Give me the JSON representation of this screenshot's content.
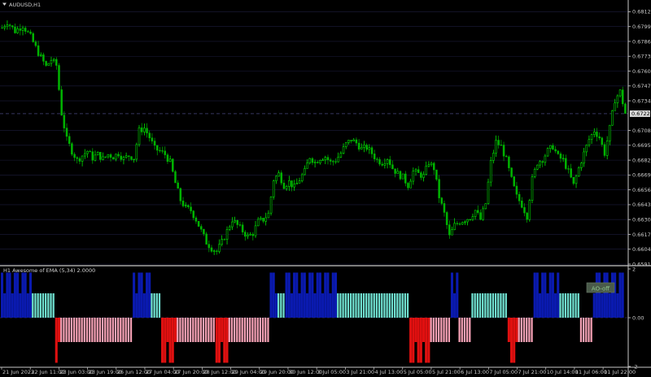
{
  "window": {
    "symbol_title": "AUDUSD,H1",
    "indicator_title": "H1 Awesome of EMA (5,34) 2.0000",
    "ao_button": "AO-off"
  },
  "colors": {
    "background": "#000000",
    "candle_up": "#00ff00",
    "candle_down": "#00b400",
    "grid": "#1c1c3c",
    "price_line": "#363660",
    "current_price_bg": "#d8d8d8",
    "ao_blue": "#0a1ab0",
    "ao_cyan": "#6fe0d0",
    "ao_red": "#e01010",
    "ao_pink": "#f4a0b4",
    "button_bg": "#4a5a4a",
    "button_text": "#8cc68c"
  },
  "icons": {
    "menu": "triangle-down-icon"
  },
  "chart_data": [
    {
      "type": "candlestick",
      "title": "AUDUSD,H1",
      "price_axis_ticks": [
        "0.68120",
        "0.67990",
        "0.67860",
        "0.67730",
        "0.67600",
        "0.67470",
        "0.67340",
        "0.67080",
        "0.66950",
        "0.66820",
        "0.66690",
        "0.66560",
        "0.66430",
        "0.66300",
        "0.66170",
        "0.66040",
        "0.65910"
      ],
      "current_price": "0.67227",
      "ylim": [
        0.6591,
        0.6818
      ],
      "time_axis_labels": [
        "21 Jun 2023",
        "22 Jun 11:00",
        "23 Jun 03:00",
        "23 Jun 19:00",
        "26 Jun 12:00",
        "27 Jun 04:00",
        "27 Jun 20:00",
        "28 Jun 12:00",
        "29 Jun 04:00",
        "29 Jun 20:00",
        "30 Jun 12:00",
        "3 Jul 05:00",
        "3 Jul 21:00",
        "4 Jul 13:00",
        "5 Jul 05:00",
        "5 Jul 21:00",
        "6 Jul 13:00",
        "7 Jul 05:00",
        "7 Jul 21:00",
        "10 Jul 14:00",
        "11 Jul 06:00",
        "11 Jul 22:00"
      ],
      "close_path": [
        [
          0,
          0.6798
        ],
        [
          2,
          0.6803
        ],
        [
          5,
          0.6795
        ],
        [
          8,
          0.68
        ],
        [
          11,
          0.679
        ],
        [
          14,
          0.6776
        ],
        [
          17,
          0.6764
        ],
        [
          19,
          0.677
        ],
        [
          21,
          0.6765
        ],
        [
          23,
          0.6723
        ],
        [
          25,
          0.67
        ],
        [
          27,
          0.669
        ],
        [
          29,
          0.6682
        ],
        [
          31,
          0.6686
        ],
        [
          33,
          0.669
        ],
        [
          35,
          0.6684
        ],
        [
          37,
          0.6687
        ],
        [
          39,
          0.6683
        ],
        [
          41,
          0.6687
        ],
        [
          43,
          0.6685
        ],
        [
          45,
          0.6688
        ],
        [
          47,
          0.6683
        ],
        [
          49,
          0.6686
        ],
        [
          51,
          0.6684
        ],
        [
          53,
          0.6708
        ],
        [
          55,
          0.671
        ],
        [
          57,
          0.6702
        ],
        [
          59,
          0.6692
        ],
        [
          61,
          0.669
        ],
        [
          63,
          0.6687
        ],
        [
          65,
          0.668
        ],
        [
          67,
          0.6662
        ],
        [
          69,
          0.6647
        ],
        [
          71,
          0.664
        ],
        [
          73,
          0.6638
        ],
        [
          75,
          0.663
        ],
        [
          77,
          0.662
        ],
        [
          79,
          0.661
        ],
        [
          81,
          0.6605
        ],
        [
          83,
          0.6602
        ],
        [
          85,
          0.661
        ],
        [
          87,
          0.662
        ],
        [
          89,
          0.663
        ],
        [
          91,
          0.6625
        ],
        [
          93,
          0.662
        ],
        [
          95,
          0.6615
        ],
        [
          97,
          0.6618
        ],
        [
          99,
          0.6628
        ],
        [
          101,
          0.663
        ],
        [
          103,
          0.6635
        ],
        [
          105,
          0.6665
        ],
        [
          107,
          0.667
        ],
        [
          109,
          0.666
        ],
        [
          111,
          0.6663
        ],
        [
          113,
          0.6658
        ],
        [
          115,
          0.6665
        ],
        [
          117,
          0.6672
        ],
        [
          119,
          0.6685
        ],
        [
          121,
          0.668
        ],
        [
          123,
          0.6684
        ],
        [
          125,
          0.6685
        ],
        [
          127,
          0.668
        ],
        [
          129,
          0.6682
        ],
        [
          131,
          0.6688
        ],
        [
          133,
          0.6696
        ],
        [
          135,
          0.67
        ],
        [
          137,
          0.6697
        ],
        [
          139,
          0.6692
        ],
        [
          141,
          0.6693
        ],
        [
          143,
          0.6688
        ],
        [
          145,
          0.6682
        ],
        [
          147,
          0.668
        ],
        [
          149,
          0.6684
        ],
        [
          151,
          0.6675
        ],
        [
          153,
          0.667
        ],
        [
          155,
          0.6667
        ],
        [
          157,
          0.666
        ],
        [
          159,
          0.6672
        ],
        [
          161,
          0.667
        ],
        [
          163,
          0.6668
        ],
        [
          165,
          0.668
        ],
        [
          167,
          0.6675
        ],
        [
          169,
          0.665
        ],
        [
          171,
          0.6635
        ],
        [
          173,
          0.6615
        ],
        [
          175,
          0.6625
        ],
        [
          177,
          0.6628
        ],
        [
          179,
          0.663
        ],
        [
          181,
          0.6632
        ],
        [
          183,
          0.6638
        ],
        [
          185,
          0.663
        ],
        [
          187,
          0.6644
        ],
        [
          189,
          0.668
        ],
        [
          191,
          0.6698
        ],
        [
          193,
          0.6694
        ],
        [
          195,
          0.6682
        ],
        [
          197,
          0.6665
        ],
        [
          199,
          0.665
        ],
        [
          201,
          0.6643
        ],
        [
          203,
          0.6633
        ],
        [
          205,
          0.6665
        ],
        [
          207,
          0.668
        ],
        [
          209,
          0.6683
        ],
        [
          211,
          0.669
        ],
        [
          213,
          0.6694
        ],
        [
          215,
          0.6685
        ],
        [
          217,
          0.6682
        ],
        [
          219,
          0.6672
        ],
        [
          221,
          0.666
        ],
        [
          223,
          0.6675
        ],
        [
          225,
          0.6688
        ],
        [
          227,
          0.67
        ],
        [
          229,
          0.6708
        ],
        [
          231,
          0.6702
        ],
        [
          233,
          0.6688
        ],
        [
          235,
          0.671
        ],
        [
          237,
          0.6735
        ],
        [
          239,
          0.6742
        ],
        [
          241,
          0.6723
        ]
      ]
    },
    {
      "type": "histogram",
      "title": "H1 Awesome of EMA (5,34) 2.0000",
      "axis_ticks": [
        "2",
        "0.00",
        "-2"
      ],
      "ylim": [
        -2,
        2
      ],
      "bar_levels": [
        1.85,
        1.0,
        -1.0,
        -1.85
      ],
      "segments": [
        {
          "from": 0,
          "to": 12,
          "sign": "pos",
          "shade": "dark"
        },
        {
          "from": 12,
          "to": 21,
          "sign": "pos",
          "shade": "light"
        },
        {
          "from": 21,
          "to": 23,
          "sign": "neg",
          "shade": "dark"
        },
        {
          "from": 23,
          "to": 51,
          "sign": "neg",
          "shade": "light"
        },
        {
          "from": 51,
          "to": 58,
          "sign": "pos",
          "shade": "dark"
        },
        {
          "from": 58,
          "to": 62,
          "sign": "pos",
          "shade": "light"
        },
        {
          "from": 62,
          "to": 68,
          "sign": "neg",
          "shade": "dark"
        },
        {
          "from": 68,
          "to": 83,
          "sign": "neg",
          "shade": "light"
        },
        {
          "from": 83,
          "to": 88,
          "sign": "neg",
          "shade": "dark"
        },
        {
          "from": 88,
          "to": 104,
          "sign": "neg",
          "shade": "light"
        },
        {
          "from": 104,
          "to": 107,
          "sign": "pos",
          "shade": "dark"
        },
        {
          "from": 107,
          "to": 110,
          "sign": "pos",
          "shade": "light"
        },
        {
          "from": 110,
          "to": 130,
          "sign": "pos",
          "shade": "dark"
        },
        {
          "from": 130,
          "to": 158,
          "sign": "pos",
          "shade": "light"
        },
        {
          "from": 158,
          "to": 166,
          "sign": "neg",
          "shade": "dark"
        },
        {
          "from": 166,
          "to": 174,
          "sign": "neg",
          "shade": "light"
        },
        {
          "from": 174,
          "to": 177,
          "sign": "pos",
          "shade": "dark"
        },
        {
          "from": 177,
          "to": 182,
          "sign": "neg",
          "shade": "light"
        },
        {
          "from": 182,
          "to": 196,
          "sign": "pos",
          "shade": "light"
        },
        {
          "from": 196,
          "to": 200,
          "sign": "neg",
          "shade": "dark"
        },
        {
          "from": 200,
          "to": 206,
          "sign": "neg",
          "shade": "light"
        },
        {
          "from": 206,
          "to": 216,
          "sign": "pos",
          "shade": "dark"
        },
        {
          "from": 216,
          "to": 224,
          "sign": "pos",
          "shade": "light"
        },
        {
          "from": 224,
          "to": 229,
          "sign": "neg",
          "shade": "light"
        },
        {
          "from": 229,
          "to": 241,
          "sign": "pos",
          "shade": "dark"
        }
      ]
    }
  ]
}
